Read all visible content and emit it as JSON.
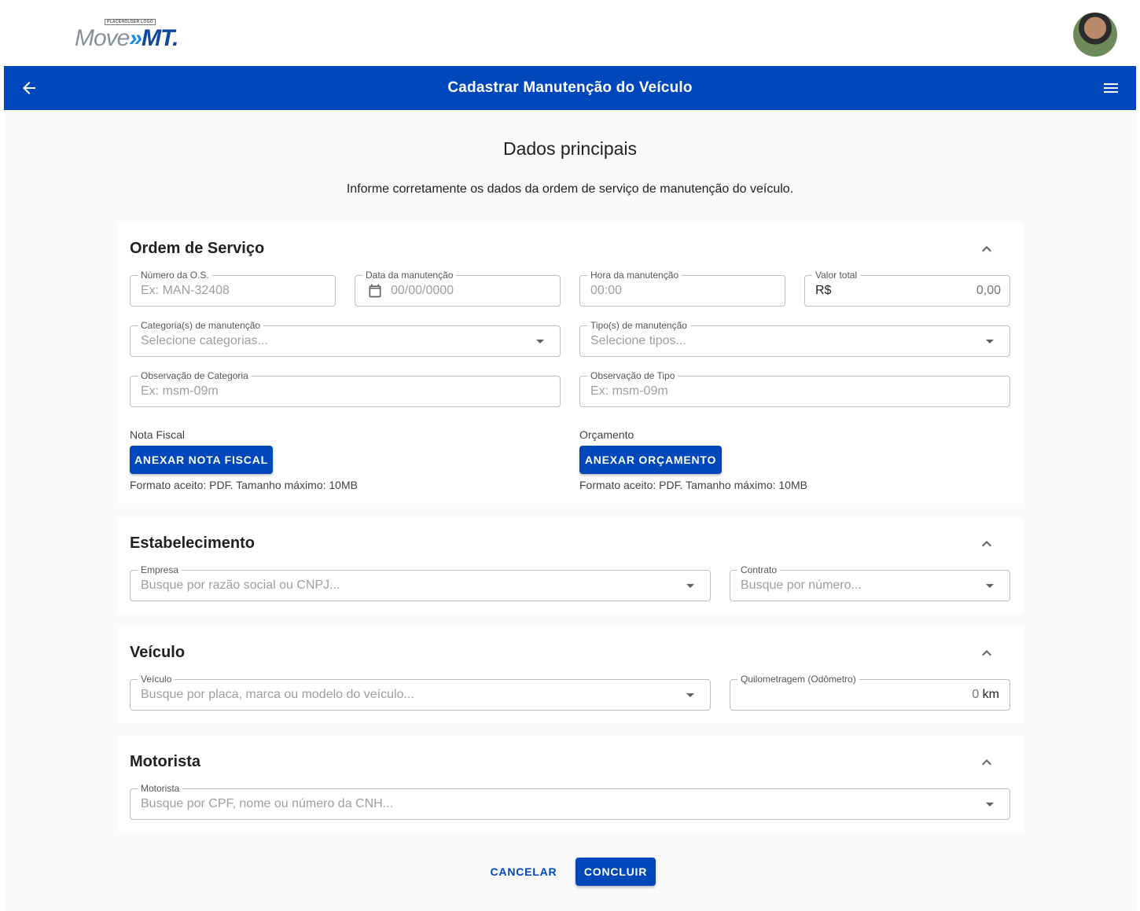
{
  "brand": {
    "placeholder": "PLACEHOLDER LOGO",
    "name_move": "Move",
    "name_chevrons": "»",
    "name_mt": "MT."
  },
  "appbar": {
    "title": "Cadastrar Manutenção do Veículo"
  },
  "page": {
    "heading": "Dados principais",
    "subheading": "Informe corretamente os dados da ordem de serviço de manutenção do veículo."
  },
  "ordem": {
    "title": "Ordem de Serviço",
    "numero": {
      "label": "Número da O.S.",
      "placeholder": "Ex: MAN-32408"
    },
    "data": {
      "label": "Data da manutenção",
      "placeholder": "00/00/0000"
    },
    "hora": {
      "label": "Hora da manutenção",
      "placeholder": "00:00"
    },
    "valor": {
      "label": "Valor total",
      "prefix": "R$",
      "value": "0,00"
    },
    "categorias": {
      "label": "Categoria(s) de manutenção",
      "placeholder": "Selecione categorias..."
    },
    "tipos": {
      "label": "Tipo(s) de manutenção",
      "placeholder": "Selecione tipos..."
    },
    "obs_categoria": {
      "label": "Observação de Categoria",
      "placeholder": "Ex: msm-09m"
    },
    "obs_tipo": {
      "label": "Observação de Tipo",
      "placeholder": "Ex: msm-09m"
    },
    "nota_fiscal": {
      "label": "Nota Fiscal",
      "button": "ANEXAR NOTA FISCAL",
      "hint": "Formato aceito: PDF. Tamanho máximo: 10MB"
    },
    "orcamento": {
      "label": "Orçamento",
      "button": "ANEXAR ORÇAMENTO",
      "hint": "Formato aceito: PDF. Tamanho máximo: 10MB"
    }
  },
  "estabelecimento": {
    "title": "Estabelecimento",
    "empresa": {
      "label": "Empresa",
      "placeholder": "Busque por razão social ou CNPJ..."
    },
    "contrato": {
      "label": "Contrato",
      "placeholder": "Busque por número..."
    }
  },
  "veiculo": {
    "title": "Veículo",
    "veiculo": {
      "label": "Veículo",
      "placeholder": "Busque por placa, marca ou modelo do veículo..."
    },
    "quilometragem": {
      "label": "Quilometragem (Odômetro)",
      "value": "0",
      "unit": "km"
    }
  },
  "motorista": {
    "title": "Motorista",
    "motorista": {
      "label": "Motorista",
      "placeholder": "Busque por CPF, nome ou número da CNH..."
    }
  },
  "actions": {
    "cancel": "CANCELAR",
    "submit": "CONCLUIR"
  },
  "colors": {
    "primary": "#0047bb",
    "background": "#fafafa"
  },
  "icons": {
    "back": "arrow-left-icon",
    "menu": "hamburger-menu-icon",
    "collapse": "chevron-up-icon",
    "calendar": "calendar-icon",
    "dropdown": "caret-down-icon"
  }
}
